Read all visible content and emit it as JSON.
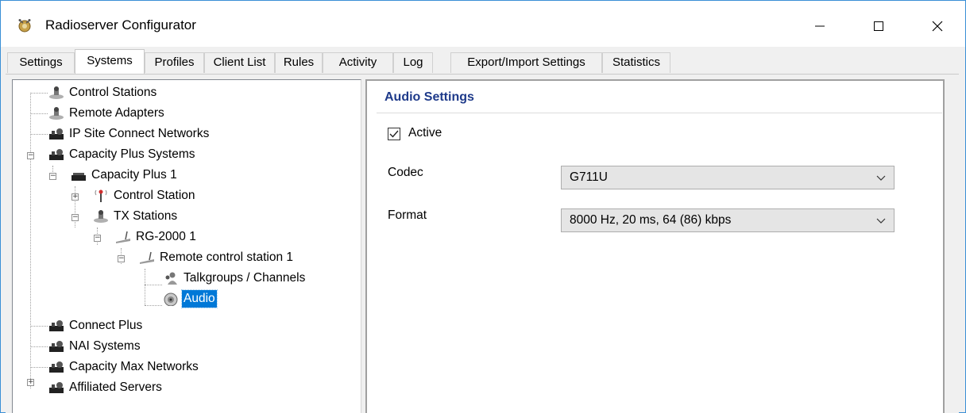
{
  "window": {
    "title": "Radioserver Configurator"
  },
  "tabs": [
    {
      "label": "Settings"
    },
    {
      "label": "Systems"
    },
    {
      "label": "Profiles"
    },
    {
      "label": "Client List"
    },
    {
      "label": "Rules"
    },
    {
      "label": "Activity"
    },
    {
      "label": "Log"
    },
    {
      "label": "Export/Import Settings"
    },
    {
      "label": "Statistics"
    }
  ],
  "tree": {
    "items": [
      {
        "label": "Control Stations",
        "icon": "radio-station-icon"
      },
      {
        "label": "Remote Adapters",
        "icon": "radio-station-icon"
      },
      {
        "label": "IP Site Connect Networks",
        "icon": "network-icon"
      },
      {
        "label": "Capacity Plus Systems",
        "icon": "network-icon"
      },
      {
        "label": "Capacity Plus 1",
        "icon": "network-icon"
      },
      {
        "label": "Control Station",
        "icon": "antenna-icon"
      },
      {
        "label": "TX Stations",
        "icon": "radio-station-icon"
      },
      {
        "label": "RG-2000 1",
        "icon": "radio-gateway-icon"
      },
      {
        "label": "Remote control station 1",
        "icon": "radio-gateway-icon"
      },
      {
        "label": "Talkgroups / Channels",
        "icon": "users-icon"
      },
      {
        "label": "Audio",
        "icon": "speaker-icon"
      },
      {
        "label": "Connect Plus",
        "icon": "network-icon"
      },
      {
        "label": "NAI Systems",
        "icon": "network-icon"
      },
      {
        "label": "Capacity Max Networks",
        "icon": "network-icon"
      },
      {
        "label": "Affiliated Servers",
        "icon": "network-icon"
      }
    ],
    "selected": "Audio"
  },
  "audio_settings": {
    "title": "Audio Settings",
    "active_label": "Active",
    "active_checked": true,
    "codec_label": "Codec",
    "codec_value": "G711U",
    "format_label": "Format",
    "format_value": "8000 Hz, 20 ms, 64 (86) kbps"
  },
  "colors": {
    "selection": "#0078d7",
    "panel_title": "#1e3a8a",
    "window_border": "#3a8fd6"
  }
}
